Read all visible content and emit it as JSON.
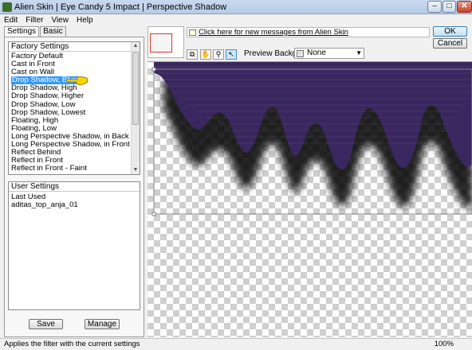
{
  "window": {
    "title": "Alien Skin | Eye Candy 5 Impact | Perspective Shadow"
  },
  "menu": [
    "Edit",
    "Filter",
    "View",
    "Help"
  ],
  "tabs": [
    "Settings",
    "Basic"
  ],
  "factory_settings": {
    "header": "Factory Settings",
    "items": [
      "Factory Default",
      "Cast in Front",
      "Cast on Wall",
      "Drop Shadow, Blurry",
      "Drop Shadow, High",
      "Drop Shadow, Higher",
      "Drop Shadow, Low",
      "Drop Shadow, Lowest",
      "Floating, High",
      "Floating, Low",
      "Long Perspective Shadow, in Back",
      "Long Perspective Shadow, in Front",
      "Reflect Behind",
      "Reflect in Front",
      "Reflect in Front - Faint"
    ],
    "selected": "Drop Shadow, Blurry"
  },
  "user_settings": {
    "header": "User Settings",
    "items": [
      "Last Used",
      "aditas_top_anja_01"
    ]
  },
  "buttons": {
    "save": "Save",
    "manage": "Manage",
    "ok": "OK",
    "cancel": "Cancel"
  },
  "news": {
    "link_text": "Click here for new messages from Alien Skin"
  },
  "preview_background": {
    "label": "Preview Background:",
    "value": "None"
  },
  "status": {
    "text": "Applies the filter with the current settings",
    "zoom": "100%"
  },
  "colors": {
    "shape": "#3b275f",
    "selection": "#3399ff"
  }
}
